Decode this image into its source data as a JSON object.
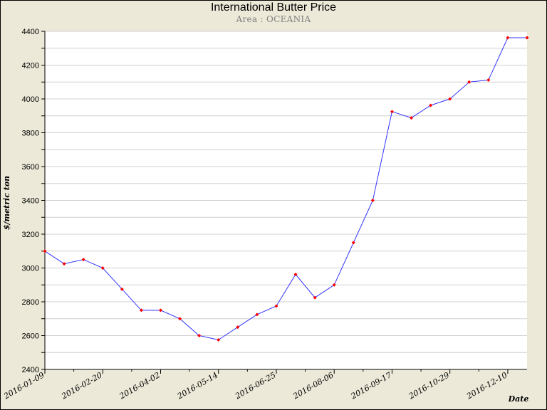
{
  "chart_data": {
    "type": "line",
    "title": "International Butter Price",
    "subtitle": "Area : OCEANIA",
    "xlabel": "Date",
    "ylabel": "$/metric ton",
    "ylim": [
      2400,
      4400
    ],
    "yticks": [
      2400,
      2600,
      2800,
      3000,
      3200,
      3400,
      3600,
      3800,
      4000,
      4200,
      4400
    ],
    "xticks": [
      "2016-01-09",
      "2016-02-20",
      "2016-04-02",
      "2016-05-14",
      "2016-06-25",
      "2016-08-06",
      "2016-09-17",
      "2016-10-29",
      "2016-12-10"
    ],
    "grid": true,
    "series": [
      {
        "color": "#3333ff",
        "marker_color": "#ff0000",
        "x": [
          "2016-01-09",
          "2016-01-23",
          "2016-02-06",
          "2016-02-20",
          "2016-03-05",
          "2016-03-19",
          "2016-04-02",
          "2016-04-16",
          "2016-04-30",
          "2016-05-14",
          "2016-05-28",
          "2016-06-11",
          "2016-06-25",
          "2016-07-09",
          "2016-07-23",
          "2016-08-06",
          "2016-08-20",
          "2016-09-03",
          "2016-09-17",
          "2016-10-01",
          "2016-10-15",
          "2016-10-29",
          "2016-11-12",
          "2016-11-26",
          "2016-12-10",
          "2016-12-24"
        ],
        "values": [
          3100,
          3025,
          3050,
          3000,
          2875,
          2750,
          2750,
          2700,
          2600,
          2575,
          2650,
          2725,
          2775,
          2962,
          2825,
          2900,
          3150,
          3400,
          3925,
          3888,
          3962,
          4000,
          4100,
          4112,
          4362,
          4362
        ]
      }
    ]
  }
}
